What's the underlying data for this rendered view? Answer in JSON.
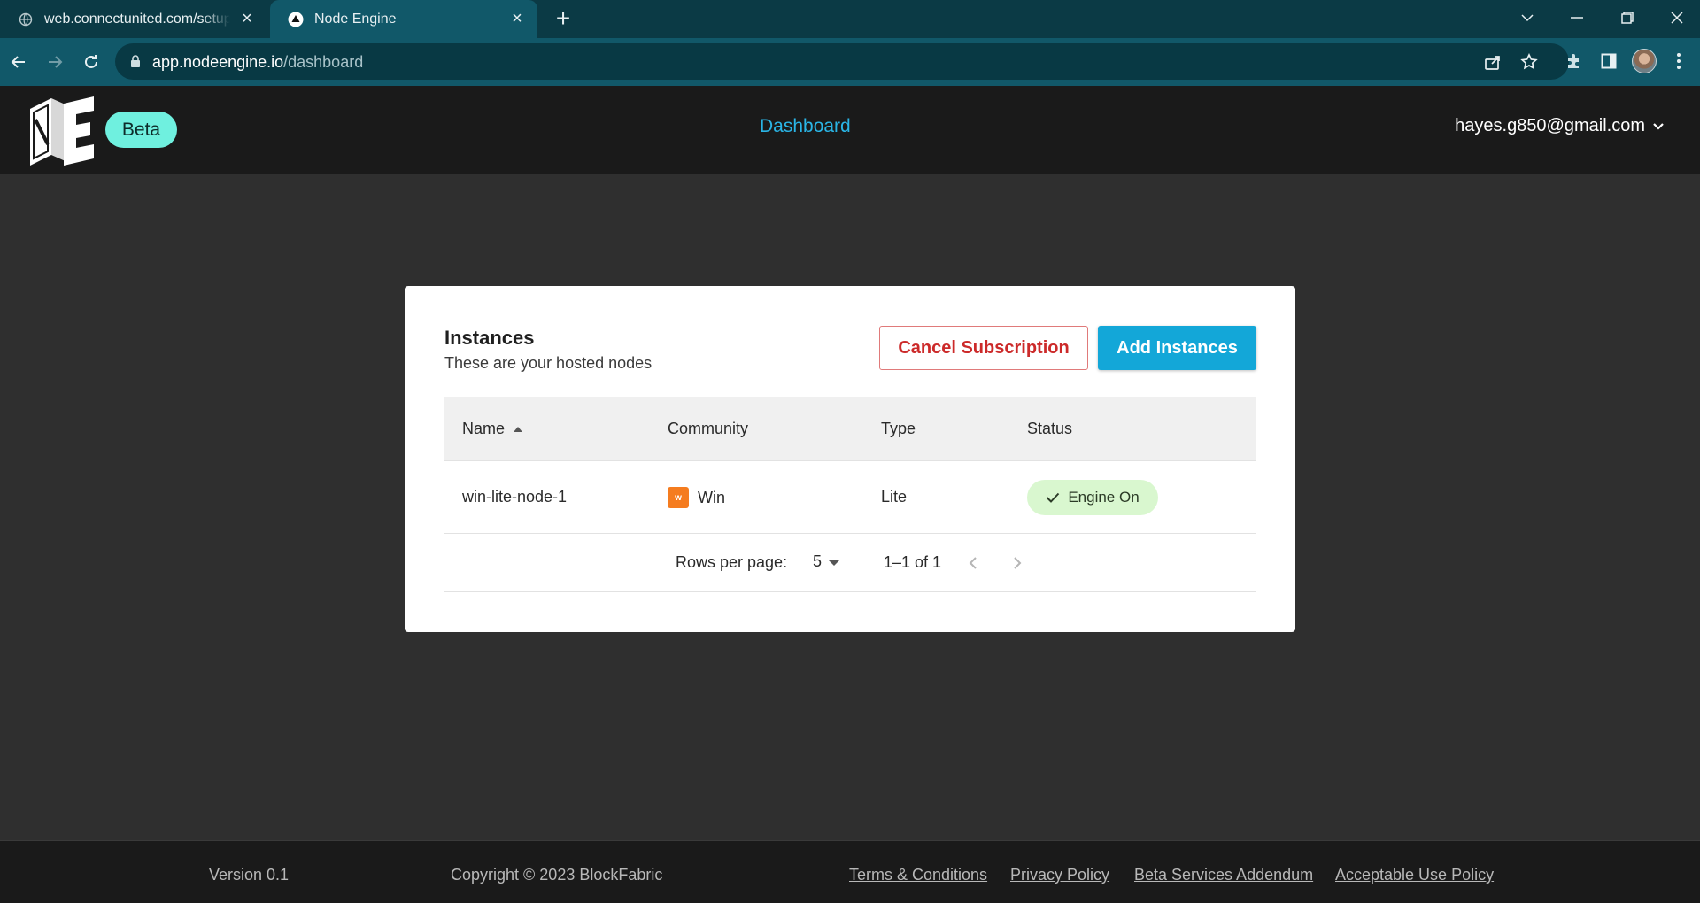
{
  "browser": {
    "tabs": [
      {
        "title": "web.connectunited.com/setup-n",
        "active": false
      },
      {
        "title": "Node Engine",
        "active": true
      }
    ],
    "url_host": "app.nodeengine.io",
    "url_path": "/dashboard"
  },
  "header": {
    "logo_text": "NE",
    "beta_label": "Beta",
    "nav_dashboard": "Dashboard",
    "user_email": "hayes.g850@gmail.com"
  },
  "instances": {
    "title": "Instances",
    "subtitle": "These are your hosted nodes",
    "cancel_label": "Cancel Subscription",
    "add_label": "Add Instances",
    "columns": {
      "name": "Name",
      "community": "Community",
      "type": "Type",
      "status": "Status"
    },
    "rows": [
      {
        "name": "win-lite-node-1",
        "community": "Win",
        "community_icon": "w",
        "type": "Lite",
        "status": "Engine On"
      }
    ],
    "pagination": {
      "rows_per_page_label": "Rows per page:",
      "rows_per_page": "5",
      "range": "1–1 of 1"
    }
  },
  "footer": {
    "version": "Version 0.1",
    "copyright": "Copyright © 2023 BlockFabric",
    "links": [
      "Terms & Conditions",
      "Privacy Policy",
      "Beta Services Addendum",
      "Acceptable Use Policy"
    ]
  },
  "colors": {
    "accent": "#13a7d8",
    "beta": "#6ff0df",
    "danger": "#cc2a2a",
    "status_on": "#d9f7cf",
    "community_win": "#f57c1f"
  }
}
